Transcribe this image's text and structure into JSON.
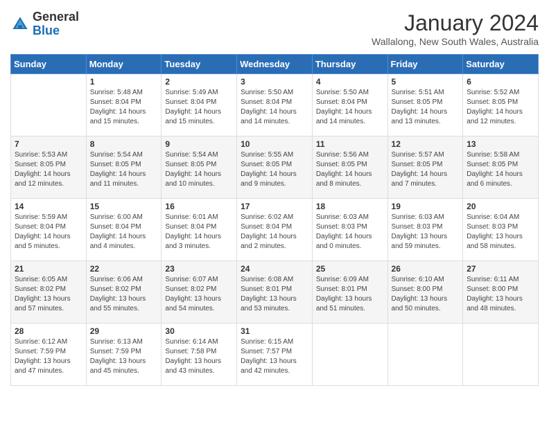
{
  "header": {
    "logo_line1": "General",
    "logo_line2": "Blue",
    "month": "January 2024",
    "location": "Wallalong, New South Wales, Australia"
  },
  "days_of_week": [
    "Sunday",
    "Monday",
    "Tuesday",
    "Wednesday",
    "Thursday",
    "Friday",
    "Saturday"
  ],
  "weeks": [
    [
      {
        "day": "",
        "info": ""
      },
      {
        "day": "1",
        "info": "Sunrise: 5:48 AM\nSunset: 8:04 PM\nDaylight: 14 hours\nand 15 minutes."
      },
      {
        "day": "2",
        "info": "Sunrise: 5:49 AM\nSunset: 8:04 PM\nDaylight: 14 hours\nand 15 minutes."
      },
      {
        "day": "3",
        "info": "Sunrise: 5:50 AM\nSunset: 8:04 PM\nDaylight: 14 hours\nand 14 minutes."
      },
      {
        "day": "4",
        "info": "Sunrise: 5:50 AM\nSunset: 8:04 PM\nDaylight: 14 hours\nand 14 minutes."
      },
      {
        "day": "5",
        "info": "Sunrise: 5:51 AM\nSunset: 8:05 PM\nDaylight: 14 hours\nand 13 minutes."
      },
      {
        "day": "6",
        "info": "Sunrise: 5:52 AM\nSunset: 8:05 PM\nDaylight: 14 hours\nand 12 minutes."
      }
    ],
    [
      {
        "day": "7",
        "info": "Sunrise: 5:53 AM\nSunset: 8:05 PM\nDaylight: 14 hours\nand 12 minutes."
      },
      {
        "day": "8",
        "info": "Sunrise: 5:54 AM\nSunset: 8:05 PM\nDaylight: 14 hours\nand 11 minutes."
      },
      {
        "day": "9",
        "info": "Sunrise: 5:54 AM\nSunset: 8:05 PM\nDaylight: 14 hours\nand 10 minutes."
      },
      {
        "day": "10",
        "info": "Sunrise: 5:55 AM\nSunset: 8:05 PM\nDaylight: 14 hours\nand 9 minutes."
      },
      {
        "day": "11",
        "info": "Sunrise: 5:56 AM\nSunset: 8:05 PM\nDaylight: 14 hours\nand 8 minutes."
      },
      {
        "day": "12",
        "info": "Sunrise: 5:57 AM\nSunset: 8:05 PM\nDaylight: 14 hours\nand 7 minutes."
      },
      {
        "day": "13",
        "info": "Sunrise: 5:58 AM\nSunset: 8:05 PM\nDaylight: 14 hours\nand 6 minutes."
      }
    ],
    [
      {
        "day": "14",
        "info": "Sunrise: 5:59 AM\nSunset: 8:04 PM\nDaylight: 14 hours\nand 5 minutes."
      },
      {
        "day": "15",
        "info": "Sunrise: 6:00 AM\nSunset: 8:04 PM\nDaylight: 14 hours\nand 4 minutes."
      },
      {
        "day": "16",
        "info": "Sunrise: 6:01 AM\nSunset: 8:04 PM\nDaylight: 14 hours\nand 3 minutes."
      },
      {
        "day": "17",
        "info": "Sunrise: 6:02 AM\nSunset: 8:04 PM\nDaylight: 14 hours\nand 2 minutes."
      },
      {
        "day": "18",
        "info": "Sunrise: 6:03 AM\nSunset: 8:03 PM\nDaylight: 14 hours\nand 0 minutes."
      },
      {
        "day": "19",
        "info": "Sunrise: 6:03 AM\nSunset: 8:03 PM\nDaylight: 13 hours\nand 59 minutes."
      },
      {
        "day": "20",
        "info": "Sunrise: 6:04 AM\nSunset: 8:03 PM\nDaylight: 13 hours\nand 58 minutes."
      }
    ],
    [
      {
        "day": "21",
        "info": "Sunrise: 6:05 AM\nSunset: 8:02 PM\nDaylight: 13 hours\nand 57 minutes."
      },
      {
        "day": "22",
        "info": "Sunrise: 6:06 AM\nSunset: 8:02 PM\nDaylight: 13 hours\nand 55 minutes."
      },
      {
        "day": "23",
        "info": "Sunrise: 6:07 AM\nSunset: 8:02 PM\nDaylight: 13 hours\nand 54 minutes."
      },
      {
        "day": "24",
        "info": "Sunrise: 6:08 AM\nSunset: 8:01 PM\nDaylight: 13 hours\nand 53 minutes."
      },
      {
        "day": "25",
        "info": "Sunrise: 6:09 AM\nSunset: 8:01 PM\nDaylight: 13 hours\nand 51 minutes."
      },
      {
        "day": "26",
        "info": "Sunrise: 6:10 AM\nSunset: 8:00 PM\nDaylight: 13 hours\nand 50 minutes."
      },
      {
        "day": "27",
        "info": "Sunrise: 6:11 AM\nSunset: 8:00 PM\nDaylight: 13 hours\nand 48 minutes."
      }
    ],
    [
      {
        "day": "28",
        "info": "Sunrise: 6:12 AM\nSunset: 7:59 PM\nDaylight: 13 hours\nand 47 minutes."
      },
      {
        "day": "29",
        "info": "Sunrise: 6:13 AM\nSunset: 7:59 PM\nDaylight: 13 hours\nand 45 minutes."
      },
      {
        "day": "30",
        "info": "Sunrise: 6:14 AM\nSunset: 7:58 PM\nDaylight: 13 hours\nand 43 minutes."
      },
      {
        "day": "31",
        "info": "Sunrise: 6:15 AM\nSunset: 7:57 PM\nDaylight: 13 hours\nand 42 minutes."
      },
      {
        "day": "",
        "info": ""
      },
      {
        "day": "",
        "info": ""
      },
      {
        "day": "",
        "info": ""
      }
    ]
  ]
}
